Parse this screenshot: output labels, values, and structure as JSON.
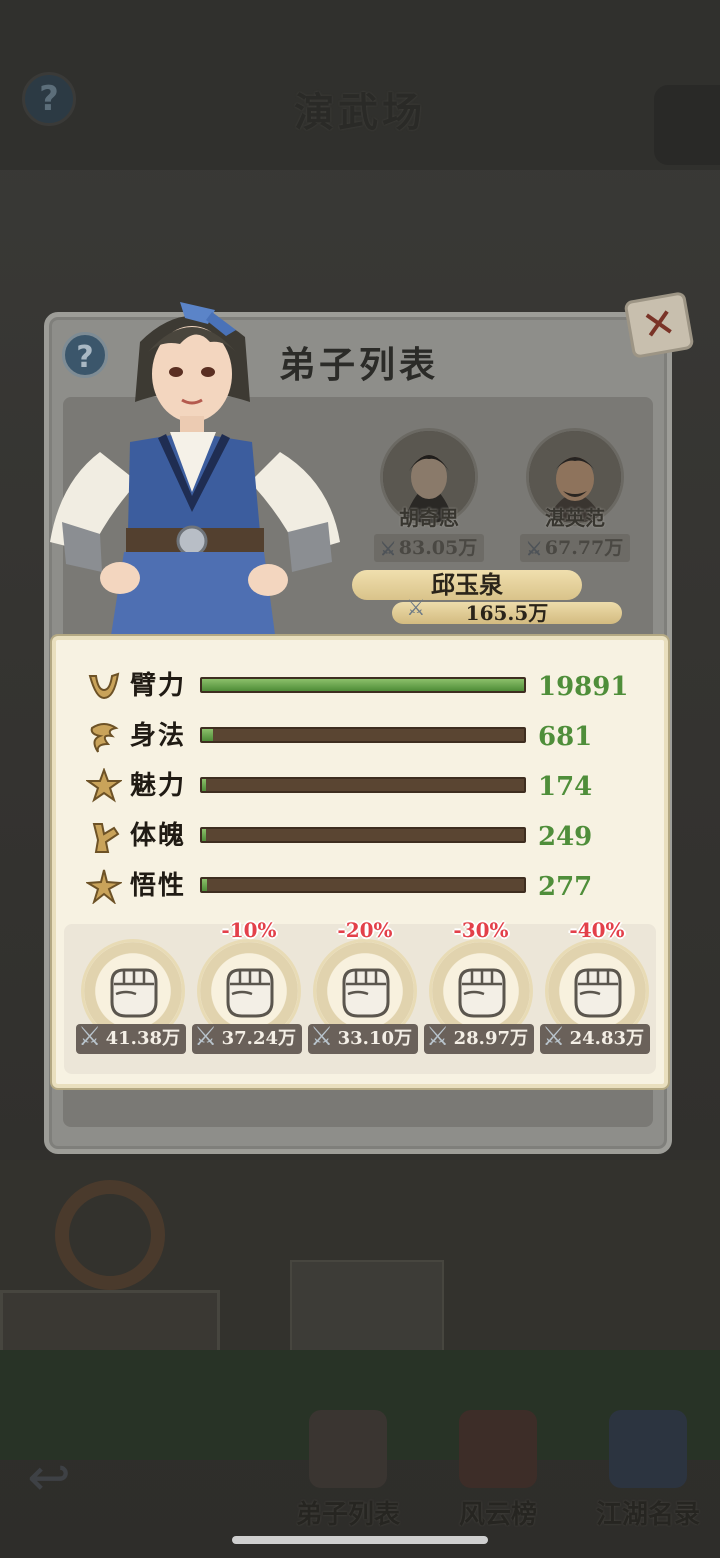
{
  "background": {
    "title": "演武场",
    "help_icon": "question-icon",
    "nav": [
      {
        "label": "弟子列表",
        "icon": "disciple-avatar-icon"
      },
      {
        "label": "风云榜",
        "icon": "scroll-icon"
      },
      {
        "label": "江湖名录",
        "icon": "book-icon"
      }
    ],
    "back_icon": "back-arrow-icon"
  },
  "popup": {
    "title": "弟子列表",
    "help_icon": "question-icon",
    "close_icon": "close-x-icon",
    "disciples": [
      {
        "name": "胡奇思",
        "power": "83.05万"
      },
      {
        "name": "湛英范",
        "power": "67.77万"
      }
    ],
    "selected": {
      "name": "邱玉泉",
      "power": "165.5万"
    }
  },
  "stats": [
    {
      "label": "臂力",
      "value": "19891",
      "icon": "arm-strength-icon",
      "fill": 1.0
    },
    {
      "label": "身法",
      "value": "681",
      "icon": "agility-icon",
      "fill": 0.034
    },
    {
      "label": "魅力",
      "value": "174",
      "icon": "charm-star-icon",
      "fill": 0.009
    },
    {
      "label": "体魄",
      "value": "249",
      "icon": "physique-icon",
      "fill": 0.013
    },
    {
      "label": "悟性",
      "value": "277",
      "icon": "insight-star-icon",
      "fill": 0.014
    }
  ],
  "training": [
    {
      "discount": "",
      "cost": "41.38万"
    },
    {
      "discount": "-10%",
      "cost": "37.24万"
    },
    {
      "discount": "-20%",
      "cost": "33.10万"
    },
    {
      "discount": "-30%",
      "cost": "28.97万"
    },
    {
      "discount": "-40%",
      "cost": "24.83万"
    }
  ],
  "colors": {
    "stat_value": "#4f8e3a",
    "discount": "#e3404a",
    "bar_fill": "#6aa84f",
    "bar_track": "#5a4532"
  }
}
